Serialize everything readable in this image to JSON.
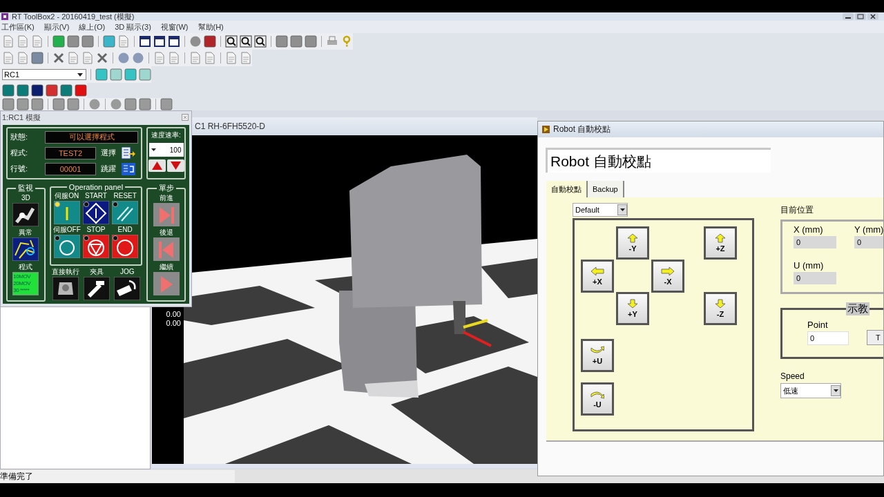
{
  "window": {
    "title": "RT ToolBox2 - 20160419_test (模擬)"
  },
  "menu": [
    "工作區(K)",
    "顯示(V)",
    "線上(O)",
    "3D 顯示(3)",
    "視窗(W)",
    "幫助(H)"
  ],
  "toolbar": {
    "controller": "RC1"
  },
  "operation_panel": {
    "title": "1:RC1 模擬",
    "rows": [
      {
        "label": "狀態:",
        "value": "可以選擇程式"
      },
      {
        "label": "程式:",
        "value": "TEST2",
        "action": "選擇"
      },
      {
        "label": "行號:",
        "value": "00001",
        "action": "跳躍"
      }
    ],
    "speed": {
      "label": "速度速率:",
      "value": "100"
    },
    "monitor": {
      "title": "監視",
      "items": [
        {
          "label": "3D",
          "kind": "robot"
        },
        {
          "label": "異常",
          "kind": "error"
        },
        {
          "label": "程式",
          "kind": "program",
          "lines": [
            "10MOV",
            "20MOV",
            "30 *****"
          ]
        }
      ]
    },
    "operation": {
      "title": "Operation panel",
      "buttons": [
        {
          "label": "伺服ON",
          "kind": "servo-on",
          "lamp_on": true
        },
        {
          "label": "START",
          "kind": "start",
          "lamp_on": false
        },
        {
          "label": "RESET",
          "kind": "reset",
          "lamp_on": false
        },
        {
          "label": "伺服OFF",
          "kind": "servo-off",
          "lamp_on": false
        },
        {
          "label": "STOP",
          "kind": "stop",
          "lamp_on": false
        },
        {
          "label": "END",
          "kind": "end",
          "lamp_on": false
        }
      ]
    },
    "direct": [
      {
        "label": "直接執行",
        "kind": "direct"
      },
      {
        "label": "夾具",
        "kind": "hand"
      },
      {
        "label": "JOG",
        "kind": "jog"
      }
    ],
    "step": {
      "title": "單步",
      "items": [
        {
          "label": "前進",
          "kind": "forward"
        },
        {
          "label": "後退",
          "kind": "back"
        },
        {
          "label": "繼續",
          "kind": "continue"
        }
      ]
    }
  },
  "view3d": {
    "title": "C1 RH-6FH5520-D",
    "readouts": [
      "0.00",
      "0.00"
    ]
  },
  "dialog": {
    "title": "Robot 自動校點",
    "heading": "Robot 自動校點",
    "tabs": [
      {
        "label": "自動校點",
        "selected": true
      },
      {
        "label": "Backup",
        "selected": false
      }
    ],
    "preset": "Default",
    "jog_buttons": [
      {
        "label": "-Y",
        "kind": "up"
      },
      {
        "label": "+Z",
        "kind": "up"
      },
      {
        "label": "+X",
        "kind": "left"
      },
      {
        "label": "-X",
        "kind": "right"
      },
      {
        "label": "+Y",
        "kind": "down"
      },
      {
        "label": "-Z",
        "kind": "down"
      },
      {
        "label": "+U",
        "kind": "ccw"
      },
      {
        "label": "-U",
        "kind": "cw"
      }
    ],
    "position": {
      "title": "目前位置",
      "fields": [
        {
          "label": "X (mm)",
          "value": "0"
        },
        {
          "label": "Y (mm)",
          "value": "0"
        },
        {
          "label": "U (mm)",
          "value": "0"
        }
      ]
    },
    "teach": {
      "title": "示教",
      "label": "Point",
      "value": "0",
      "button": "T"
    },
    "speed": {
      "label": "Speed",
      "value": "低速"
    }
  },
  "status_bar": {
    "text": "準備完了"
  }
}
